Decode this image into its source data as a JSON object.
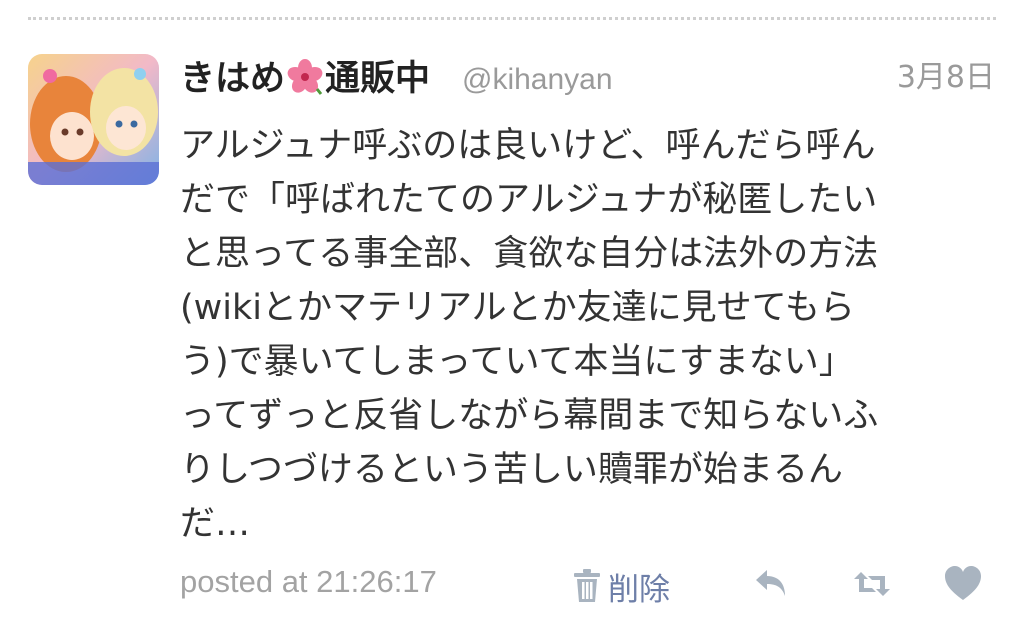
{
  "tweet": {
    "display_name_part1": "きはめ",
    "display_name_icon": "hibiscus-icon",
    "display_name_part2": "通販中",
    "handle": "@kihanyan",
    "date": "3月8日",
    "body_lines": [
      "アルジュナ呼ぶのは良いけど、呼んだら呼ん",
      "だで「呼ばれたてのアルジュナが秘匿したい",
      "と思ってる事全部、貪欲な自分は法外の方法",
      "(wikiとかマテリアルとか友達に見せてもら",
      "う)で暴いてしまっていて本当にすまない」",
      "ってずっと反省しながら幕間まで知らないふ",
      "りしつづけるという苦しい贖罪が始まるん",
      "だ…"
    ],
    "posted_at": "posted at 21:26:17",
    "delete_label": "削除"
  },
  "icons": {
    "avatar": "avatar-illustration",
    "trash": "trash-icon",
    "reply": "reply-icon",
    "retweet": "retweet-icon",
    "favorite": "heart-icon"
  },
  "colors": {
    "name": "#222222",
    "meta": "#9a9a9a",
    "body": "#333333",
    "delete_link": "#6e7fa8",
    "icons": "#a9b4c0"
  }
}
